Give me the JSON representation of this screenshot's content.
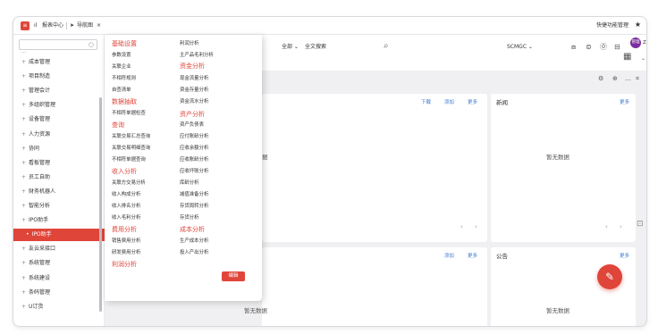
{
  "topbar": {
    "tab_report": "报表中心",
    "tab_nav": "导航图",
    "close": "×",
    "quick_menu": "快捷功能管理",
    "star": "★"
  },
  "sidebar": {
    "search_placeholder": "",
    "items": [
      {
        "label": "成本管理"
      },
      {
        "label": "项目制造"
      },
      {
        "label": "管理会计"
      },
      {
        "label": "多组织管理"
      },
      {
        "label": "设备管理"
      },
      {
        "label": "人力资源"
      },
      {
        "label": "协同"
      },
      {
        "label": "看板管理"
      },
      {
        "label": "员工自助"
      },
      {
        "label": "财务机器人"
      },
      {
        "label": "智能分析"
      },
      {
        "label": "IPO助手"
      },
      {
        "label": "IPO助手"
      },
      {
        "label": "友云采接口"
      },
      {
        "label": "系统管理"
      },
      {
        "label": "系统建设"
      },
      {
        "label": "条码管理"
      },
      {
        "label": "U订货"
      }
    ]
  },
  "flyout": {
    "col1": [
      {
        "text": "基础设置",
        "heading": true
      },
      {
        "text": "参数设置",
        "heading": false
      },
      {
        "text": "关联企业",
        "heading": false
      },
      {
        "text": "不相符规则",
        "heading": false
      },
      {
        "text": "自查清单",
        "heading": false
      },
      {
        "text": "数据抽取",
        "heading": true
      },
      {
        "text": "不相符单据检查",
        "heading": false
      },
      {
        "text": "查询",
        "heading": true
      },
      {
        "text": "关联交易汇总查询",
        "heading": false
      },
      {
        "text": "关联交易明细查询",
        "heading": false
      },
      {
        "text": "不相符单据查询",
        "heading": false
      },
      {
        "text": "收入分析",
        "heading": true
      },
      {
        "text": "关联方交易分析",
        "heading": false
      },
      {
        "text": "收入构成分析",
        "heading": false
      },
      {
        "text": "收入排名分析",
        "heading": false
      },
      {
        "text": "收入毛利分析",
        "heading": false
      },
      {
        "text": "费用分析",
        "heading": true
      },
      {
        "text": "销售费用分析",
        "heading": false
      },
      {
        "text": "研发费用分析",
        "heading": false
      },
      {
        "text": "利润分析",
        "heading": true
      }
    ],
    "col2": [
      {
        "text": "利润分析",
        "heading": false
      },
      {
        "text": "主产品毛利分析",
        "heading": false
      },
      {
        "text": "资金分析",
        "heading": true
      },
      {
        "text": "现金流量分析",
        "heading": false
      },
      {
        "text": "资金存量分析",
        "heading": false
      },
      {
        "text": "资金流水分析",
        "heading": false
      },
      {
        "text": "资产分析",
        "heading": true
      },
      {
        "text": "资产负债表",
        "heading": false
      },
      {
        "text": "应付账龄分析",
        "heading": false
      },
      {
        "text": "应收余额分析",
        "heading": false
      },
      {
        "text": "应收账龄分析",
        "heading": false
      },
      {
        "text": "应收坏账分析",
        "heading": false
      },
      {
        "text": "库龄分析",
        "heading": false
      },
      {
        "text": "减值准备分析",
        "heading": false
      },
      {
        "text": "存货周转分析",
        "heading": false
      },
      {
        "text": "存货分析",
        "heading": false
      },
      {
        "text": "成本分析",
        "heading": true
      },
      {
        "text": "生产成本分析",
        "heading": false
      },
      {
        "text": "投入产出分析",
        "heading": false
      }
    ],
    "edit_label": "编辑"
  },
  "header": {
    "scope": "全部 ⌄",
    "fulltext": "全文搜索",
    "search_icon": "⌕",
    "tenant": "SCMGC ⌄",
    "avatar_text": "管理",
    "user_initial": "ZD"
  },
  "cards": {
    "main_download": "下载",
    "main_add": "添加",
    "main_more": "更多",
    "main_partial": "据",
    "news_title": "新闻",
    "news_more": "更多",
    "news_empty": "暂无数据",
    "bottom_add": "添加",
    "bottom_more": "更多",
    "notice_title": "公告",
    "notice_more": "更多",
    "bottom_empty_left": "暂无数据",
    "bottom_empty_right": "暂无数据"
  },
  "colors": {
    "accent": "#e0453a",
    "link": "#3a7bd5",
    "avatar": "#7b2e9e"
  },
  "icons": [
    "bar-chart-icon",
    "nav-arrow-icon",
    "search-icon",
    "screen-icon",
    "cube-icon",
    "help-icon",
    "message-icon",
    "qr-code-icon",
    "settings-icon",
    "add-circle-icon",
    "more-icon",
    "expand-icon",
    "edit-pencil-icon"
  ]
}
